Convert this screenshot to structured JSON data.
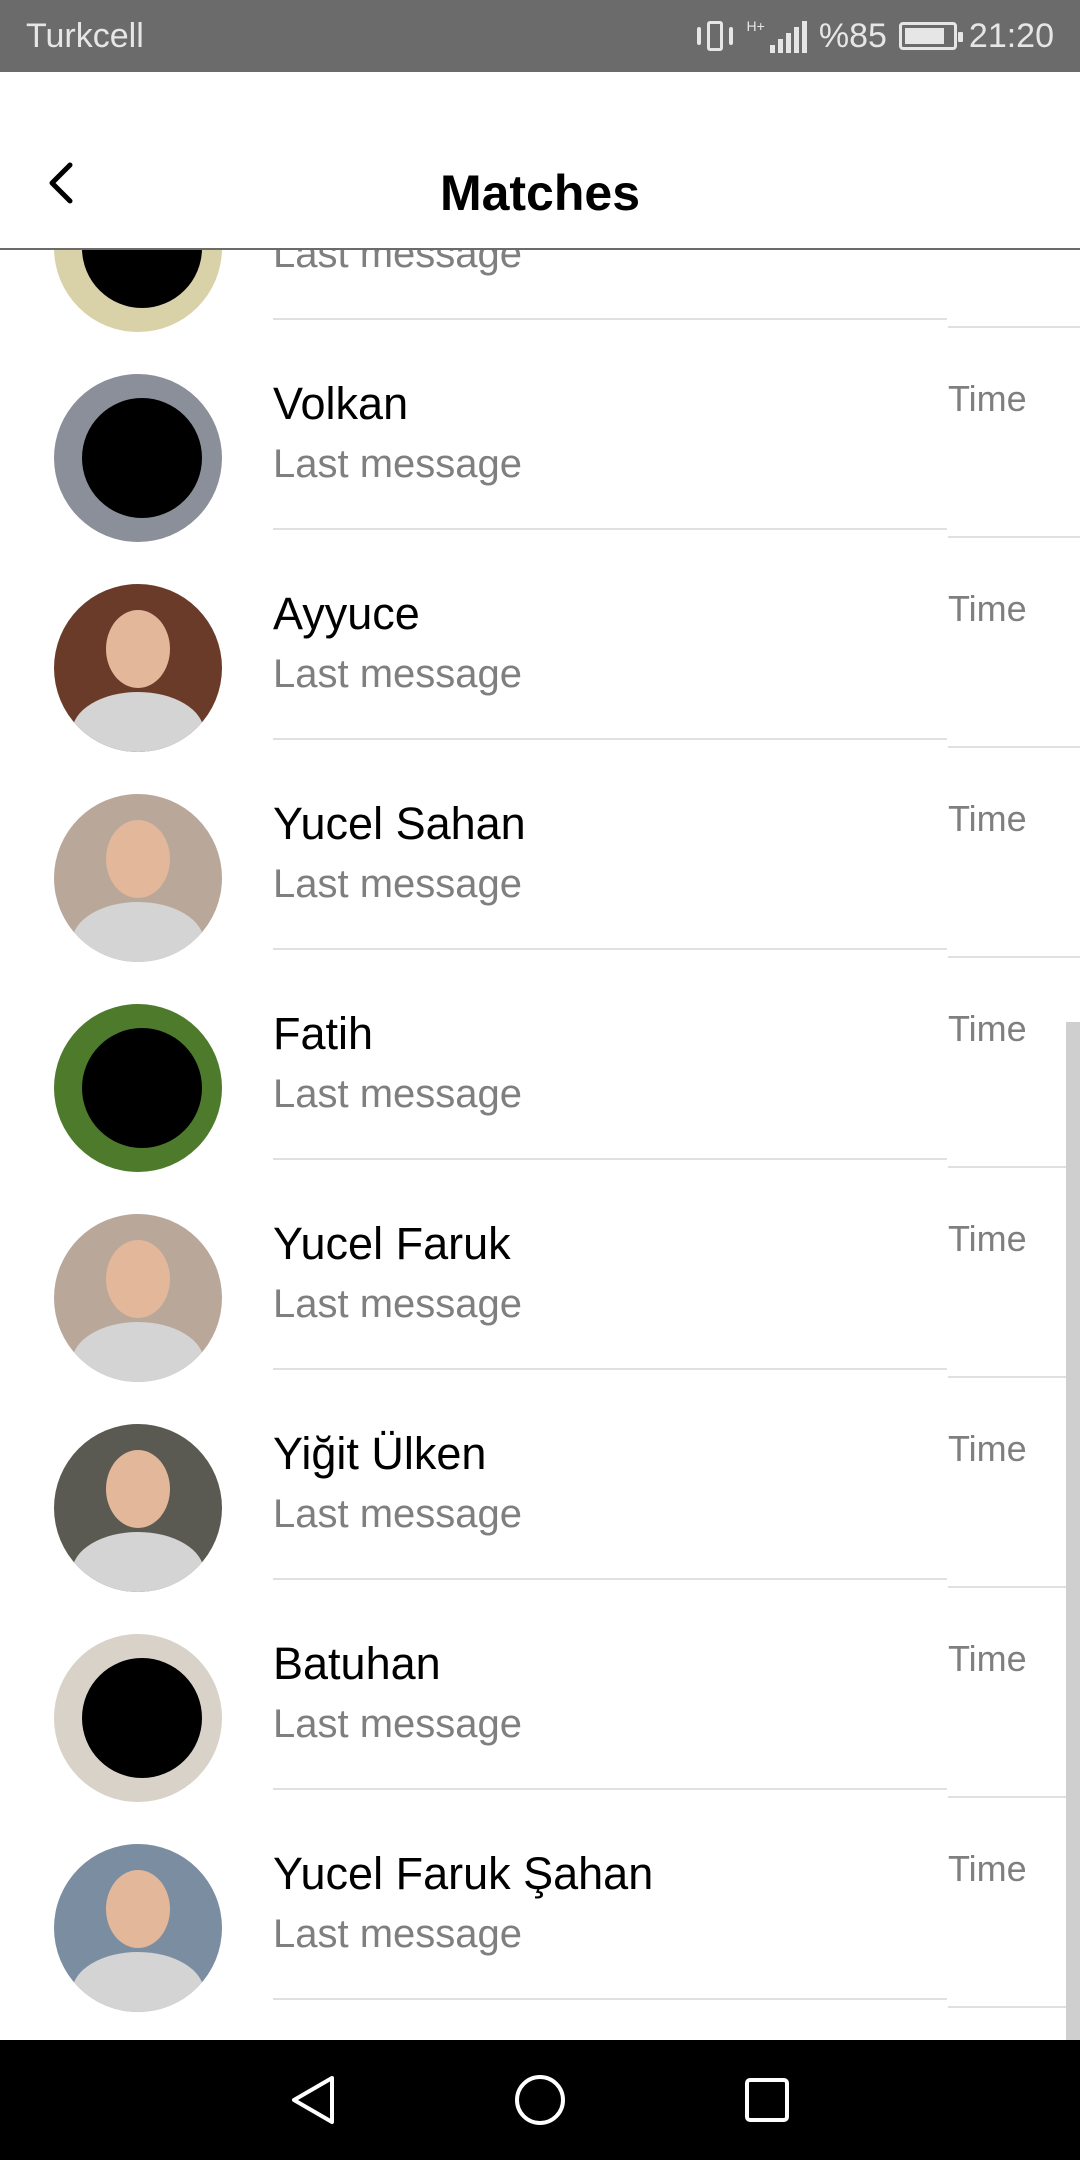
{
  "status_bar": {
    "carrier": "Turkcell",
    "network_tag": "H+",
    "battery_text": "%85",
    "battery_level": 0.85,
    "time": "21:20",
    "icons": [
      "vibrate-icon",
      "signal-icon",
      "battery-icon"
    ]
  },
  "header": {
    "title": "Matches",
    "back_icon": "chevron-left-icon"
  },
  "matches": [
    {
      "name": "",
      "last_message": "Last message",
      "time": "",
      "avatar": "redacted",
      "avatar_bg": "#d9d1a8"
    },
    {
      "name": "Volkan",
      "last_message": "Last message",
      "time": "Time",
      "avatar": "redacted",
      "avatar_bg": "#8a8f9a"
    },
    {
      "name": "Ayyuce",
      "last_message": "Last message",
      "time": "Time",
      "avatar": "photo",
      "avatar_bg": "#6b3b2a"
    },
    {
      "name": "Yucel Sahan",
      "last_message": "Last message",
      "time": "Time",
      "avatar": "photo",
      "avatar_bg": "#b9a79a"
    },
    {
      "name": "Fatih",
      "last_message": "Last message",
      "time": "Time",
      "avatar": "redacted",
      "avatar_bg": "#4e7a2c"
    },
    {
      "name": "Yucel Faruk",
      "last_message": "Last message",
      "time": "Time",
      "avatar": "photo",
      "avatar_bg": "#b9a79a"
    },
    {
      "name": "Yiğit Ülken",
      "last_message": "Last message",
      "time": "Time",
      "avatar": "photo",
      "avatar_bg": "#5a5a52"
    },
    {
      "name": "Batuhan",
      "last_message": "Last message",
      "time": "Time",
      "avatar": "redacted",
      "avatar_bg": "#d8d2c8"
    },
    {
      "name": "Yucel Faruk Şahan",
      "last_message": "Last message",
      "time": "Time",
      "avatar": "photo",
      "avatar_bg": "#7b8da0"
    }
  ],
  "nav_bar": {
    "icons": [
      "back-triangle-icon",
      "home-circle-icon",
      "recents-square-icon"
    ]
  },
  "colors": {
    "status_bar_bg": "#6b6b6b",
    "text_primary": "#000000",
    "text_secondary": "#7f7f7f",
    "divider": "#e0e0e0",
    "nav_bar_bg": "#000000"
  }
}
